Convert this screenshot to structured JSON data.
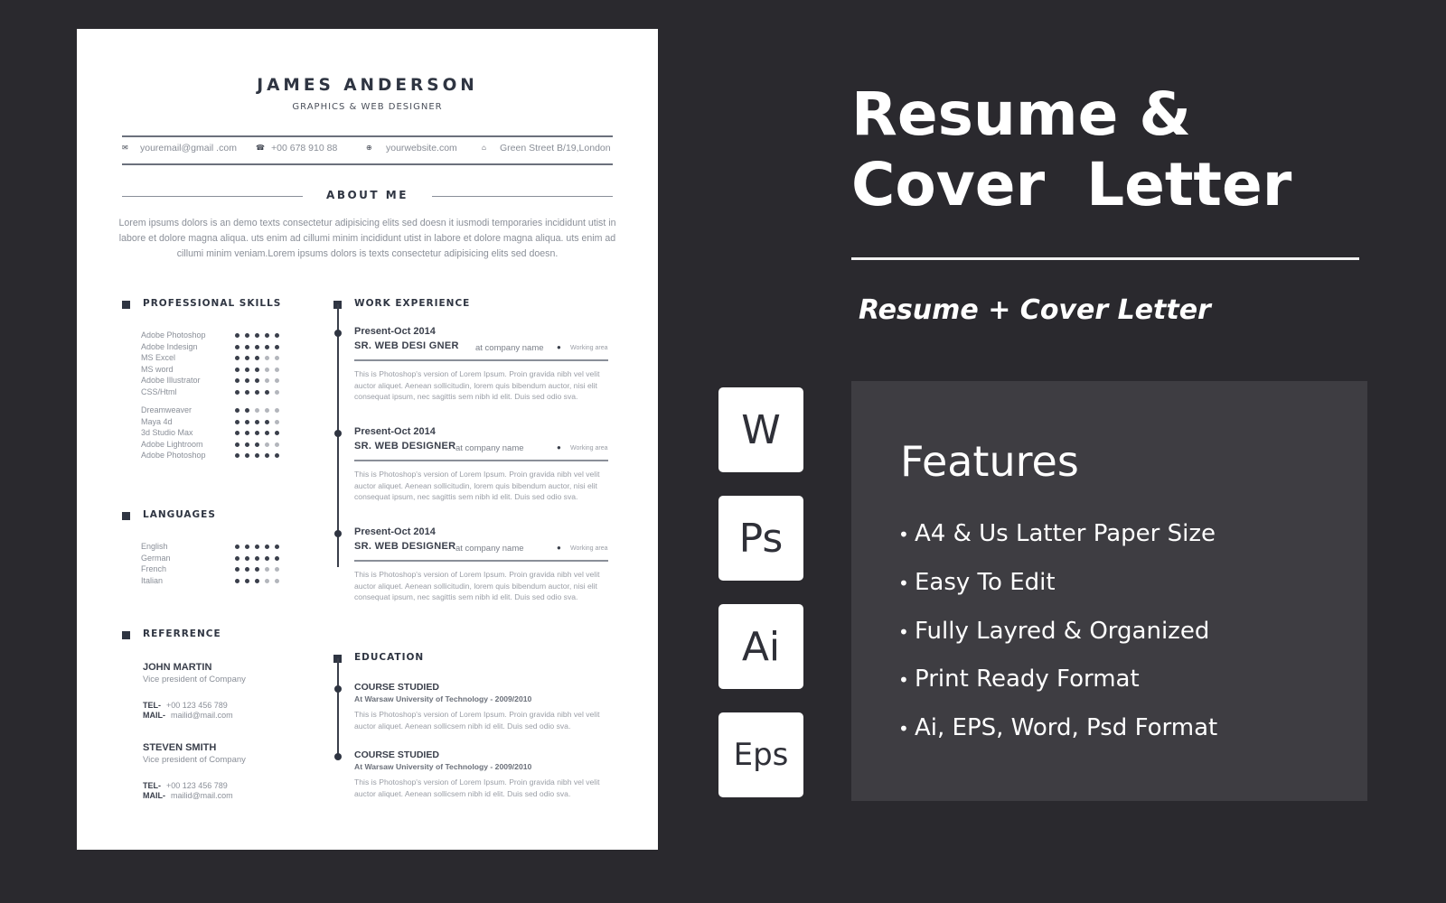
{
  "resume": {
    "name": "JAMES ANDERSON",
    "role": "GRAPHICS & WEB DESIGNER",
    "contact": [
      {
        "icon": "envelope-icon",
        "glyph": "✉",
        "text": "youremail@gmail .com"
      },
      {
        "icon": "phone-icon",
        "glyph": "☎",
        "text": "+00 678 910 88"
      },
      {
        "icon": "globe-icon",
        "glyph": "⊕",
        "text": "yourwebsite.com"
      },
      {
        "icon": "home-icon",
        "glyph": "⌂",
        "text": "Green Street B/19,London"
      }
    ],
    "about": {
      "title": "ABOUT ME",
      "text": "Lorem ipsums dolors is an demo texts consectetur adipisicing elits sed doesn it iusmodi temporaries incididunt utist in labore et dolore magna aliqua. uts enim ad cillumi minim incididunt utist in labore et dolore magna aliqua. uts enim ad cillumi minim veniam.Lorem ipsums dolors is  texts consectetur adipisicing elits sed doesn."
    },
    "skills": {
      "title": "PROFESSIONAL SKILLS",
      "items": [
        {
          "label": "Adobe Photoshop",
          "rating": 5
        },
        {
          "label": "Adobe Indesign",
          "rating": 5
        },
        {
          "label": "MS Excel",
          "rating": 3
        },
        {
          "label": "MS word",
          "rating": 3
        },
        {
          "label": "Adobe Illustrator",
          "rating": 3
        },
        {
          "label": "CSS/Html",
          "rating": 4
        },
        {
          "label": "Dreamweaver",
          "rating": 2
        },
        {
          "label": "Maya 4d",
          "rating": 4
        },
        {
          "label": "3d Studio Max",
          "rating": 5
        },
        {
          "label": "Adobe Lightroom",
          "rating": 3
        },
        {
          "label": "Adobe Photoshop",
          "rating": 5
        }
      ],
      "max": 5
    },
    "languages": {
      "title": "LANGUAGES",
      "items": [
        {
          "label": "English",
          "rating": 5
        },
        {
          "label": "German",
          "rating": 5
        },
        {
          "label": "French",
          "rating": 3
        },
        {
          "label": "Italian",
          "rating": 3
        }
      ],
      "max": 5
    },
    "reference": {
      "title": "REFERRENCE",
      "people": [
        {
          "name": "JOHN MARTIN",
          "position": "Vice president of Company",
          "tel_label": "TEL-",
          "tel": "+00 123 456 789",
          "mail_label": "MAIL-",
          "mail": "mailid@mail.com"
        },
        {
          "name": "STEVEN SMITH",
          "position": "Vice president of Company",
          "tel_label": "TEL-",
          "tel": "+00 123 456 789",
          "mail_label": "MAIL-",
          "mail": "mailid@mail.com"
        }
      ]
    },
    "work": {
      "title": "WORK EXPERIENCE",
      "jobs": [
        {
          "date": "Present-Oct 2014",
          "title": "SR. WEB DESI GNER",
          "company": "at company name",
          "location": "Working area",
          "desc": "This is Photoshop's version of Lorem Ipsum. Proin gravida nibh vel velit auctor aliquet. Aenean sollicitudin, lorem quis bibendum auctor, nisi elit consequat ipsum, nec sagittis sem nibh id elit. Duis sed odio sva."
        },
        {
          "date": "Present-Oct 2014",
          "title": "SR. WEB DESIGNER",
          "company": "at company name",
          "location": "Working area",
          "desc": "This is Photoshop's version of Lorem Ipsum. Proin gravida nibh vel velit auctor aliquet. Aenean sollicitudin, lorem quis bibendum auctor, nisi elit consequat ipsum, nec sagittis sem nibh id elit. Duis sed odio sva."
        },
        {
          "date": "Present-Oct 2014",
          "title": "SR. WEB DESIGNER",
          "company": "at company name",
          "location": "Working area",
          "desc": "This is Photoshop's version of Lorem Ipsum. Proin gravida nibh vel velit auctor aliquet. Aenean sollicitudin, lorem quis bibendum auctor, nisi elit consequat ipsum, nec sagittis sem nibh id elit. Duis sed odio sva."
        }
      ]
    },
    "education": {
      "title": "EDUCATION",
      "items": [
        {
          "title": "COURSE STUDIED",
          "school": "At Warsaw University of Technology - 2009/2010",
          "desc": "This is Photoshop's version of Lorem Ipsum. Proin gravida nibh vel velit auctor aliquet. Aenean sollicsem nibh id elit. Duis sed odio sva."
        },
        {
          "title": "COURSE STUDIED",
          "school": "At Warsaw University of Technology - 2009/2010",
          "desc": "This is Photoshop's version of Lorem Ipsum. Proin gravida nibh vel velit auctor aliquet. Aenean sollicsem nibh id elit. Duis sed odio sva."
        }
      ]
    }
  },
  "promo": {
    "title_line1": "Resume &",
    "title_line2": "Cover  Letter",
    "subtitle": "Resume + Cover Letter",
    "formats": [
      {
        "icon": "word-icon",
        "label": "W"
      },
      {
        "icon": "photoshop-icon",
        "label": "Ps"
      },
      {
        "icon": "illustrator-icon",
        "label": "Ai"
      },
      {
        "icon": "eps-icon",
        "label": "Eps"
      }
    ],
    "features": {
      "title": "Features",
      "bullet": "•",
      "items": [
        "A4 & Us Latter Paper Size",
        "Easy To Edit",
        "Fully Layred & Organized",
        "Print Ready Format",
        "Ai, EPS, Word, Psd Format"
      ]
    }
  },
  "colors": {
    "background": "#2a292e",
    "panel": "#3e3d42",
    "paper": "#ffffff",
    "ink": "#2f3542",
    "dot_on": "#3a3f4b",
    "dot_off": "#b3b6bc"
  }
}
